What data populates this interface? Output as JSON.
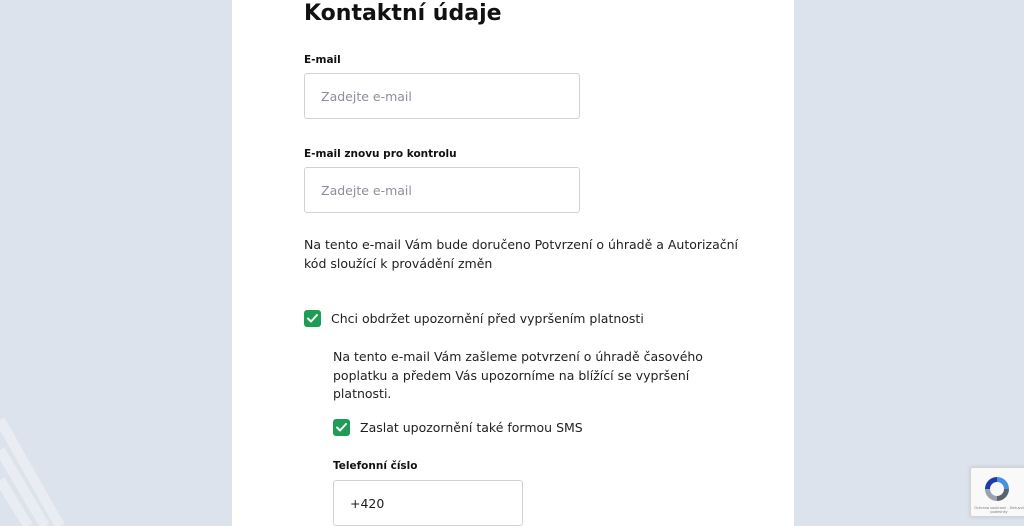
{
  "section": {
    "title": "Kontaktní údaje"
  },
  "email": {
    "label": "E-mail",
    "placeholder": "Zadejte e-mail",
    "value": ""
  },
  "email_confirm": {
    "label": "E-mail znovu pro kontrolu",
    "placeholder": "Zadejte e-mail",
    "value": ""
  },
  "email_note": {
    "line1": "Na tento e-mail Vám bude doručeno Potvrzení o úhradě a Autorizační",
    "line2": "kód sloužící k provádění změn"
  },
  "expiry_notification": {
    "label": "Chci obdržet upozornění před vypršením platnosti",
    "checked": true,
    "note_line1": "Na tento e-mail Vám zašleme potvrzení o úhradě časového",
    "note_line2": "poplatku a předem Vás upozorníme na blížící se vypršení",
    "note_line3": "platnosti."
  },
  "sms_notification": {
    "label": "Zaslat upozornění také formou SMS",
    "checked": true
  },
  "phone": {
    "label": "Telefonní číslo",
    "value": "+420"
  },
  "recaptcha": {
    "terms": "Ochrana soukromí - Smluvní podmínky"
  },
  "colors": {
    "accent": "#1f9d57",
    "page_background": "#dde3ec",
    "card_background": "#ffffff"
  },
  "icons": {
    "checkbox": "check-icon",
    "recaptcha": "recaptcha-logo-icon"
  }
}
